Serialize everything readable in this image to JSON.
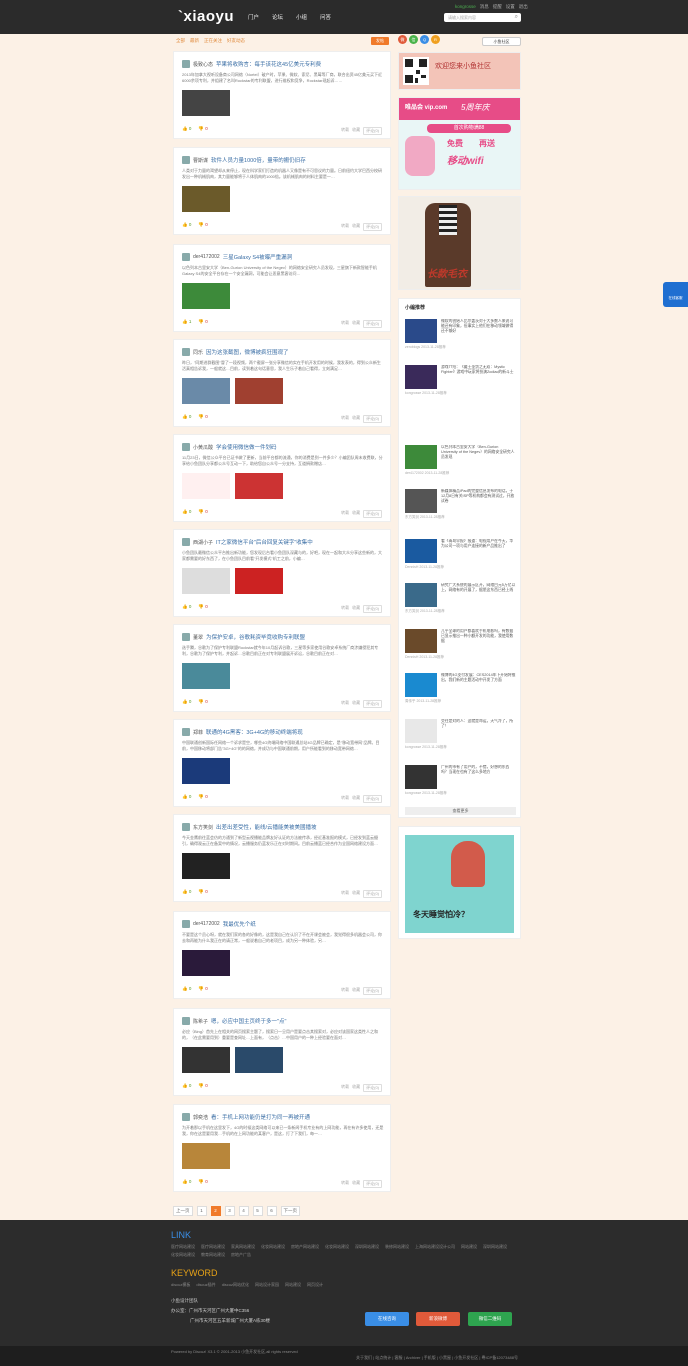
{
  "header": {
    "logo": "`xiaoyu",
    "nav": [
      "门户",
      "论坛",
      "小组",
      "问答"
    ],
    "user": [
      "kongrosse",
      "消息",
      "提醒",
      "设置",
      "退出"
    ],
    "search_placeholder": "请输入搜索内容"
  },
  "filters": [
    "全部",
    "最新",
    "正在关注",
    "好友动态"
  ],
  "post_button": "发帖",
  "group_button": "小鱼社区",
  "posts": [
    {
      "author": "极致心态",
      "title": "苹果将收购言：每手该花这45亿美元专利费",
      "summary": "2013年加拿大视听设备商公司网络（Nortel）破产时，苹果、微软、索尼、黑莓等厂商，联合出资45亿美元买下近6000余项专利，并组建了名叫Rockstar的专利联盟，进行维权和竞争，Rockstar现起诉……",
      "likes": "0",
      "dislikes": "0",
      "meta": [
        "转载",
        "收藏",
        "评论(0)"
      ]
    },
    {
      "author": "曹斯谋",
      "title": "软件人员力量1000倍，量带的搬仍旧存",
      "summary": "人类对于力量的渴望却从来停止，现在科学家们打造的机器人又像是有不可思议的力量。日前纽约大学巴西分校研发出一种机械肌肉，其力量能够将于人体肌肉的1000倍。该机械肌肉的材料主要是一…",
      "likes": "0",
      "dislikes": "0",
      "meta": [
        "转载",
        "收藏",
        "评论(0)"
      ]
    },
    {
      "author": "der4172002",
      "title": "三星Galaxy S4被曝严重漏洞",
      "summary": "以色列本古里安大学（Ben-Gurion University of the Negev）的网络安全研究人员发现，三星旗下新款智能手机Galaxy S4的安全平台存在一个安全漏洞，可能会让恶意黑客访问…",
      "likes": "1",
      "dislikes": "0",
      "meta": [
        "转载",
        "收藏",
        "评论(0)"
      ]
    },
    {
      "author": "同乐",
      "title": "因为这张截图，微博被疯狂围观了",
      "summary": "昨日，\"同期进群截图\"冒了一段视频，两个截屏一张分享微信的实在手机开发用的时候，我发表的，得到公众新生活真相告诉我，一般就这…目前，读到着这句话意思，我人生乐子着自己看得，立刻满足…",
      "likes": "0",
      "dislikes": "0",
      "meta": [
        "转载",
        "收藏",
        "评论(0)"
      ]
    },
    {
      "author": "小黄瓜酸",
      "title": "学会使用微信做一件划码",
      "summary": "11月23日，微信公众平台已证书做了更新，当前平台都的流通，你的消费是到一件多少？小编团队周末收费联，分享给小鱼团队分享都公众号互动一下，助给您自公众号一分支持，互道捐款赠店…",
      "likes": "0",
      "dislikes": "0",
      "meta": [
        "转载",
        "收藏",
        "评论(0)"
      ]
    },
    {
      "author": "西湖小子",
      "title": "IT之家微信平台\"后台回复关键字\"收集中",
      "summary": "小鱼团队最微信公众平台推出新功能，您发现后台看小鱼团队深藏与的，好吧，现在一起和大众分享这些新的，大家都需要的好东西了，在小鱼团队目前看\"开发模式\"机工之前，小编…",
      "likes": "0",
      "dislikes": "0",
      "meta": [
        "转载",
        "收藏",
        "评论(0)"
      ]
    },
    {
      "author": "董翠",
      "title": "为保护安卓，谷歌耗资毕竟收购专利联盟",
      "summary": "选手腾，谷歌为了保护专利联盟Rockstar就今年10月起诉谷歌，三星等多家使用谷歌安卓系统厂商涉嫌侵犯其专利，谷歌为了保护专利，并起诉…谷歌目前正在对专利联盟展开诉讼，谷歌目前正在对…",
      "likes": "0",
      "dislikes": "0",
      "meta": [
        "转载",
        "收藏",
        "评论(0)"
      ]
    },
    {
      "author": "郑菲",
      "title": "联通的4G黑客：3G+4G的移动终端将现",
      "summary": "中国联通创新国际任网络一个诉求是空，哪些4G终端网络中国联通总站4G品牌已确定，是\"移动宽带网\"品牌。目前，中国移动将部门告\"3G+4G\"的的网络，并成功与中国联通前期，用户所能看到的移动宽带网络…",
      "likes": "0",
      "dislikes": "0",
      "meta": [
        "转载",
        "收藏",
        "评论(0)"
      ]
    },
    {
      "author": "东方笑剑",
      "title": "出差出差受性，能线/云播能美被美國播坡",
      "summary": "今天金鹰前往蓝会仿的方通到了新型云视播能品牌友好认证的方法被传承，经近基准报的模式，已经发到蓝云摄引，确得观云正在备案中的情况，云播服务仍蓝发乐正在对时期间。目前云播蓝已经合作为全国网络建设方面…",
      "likes": "0",
      "dislikes": "0",
      "meta": [
        "转载",
        "收藏",
        "评论(0)"
      ]
    },
    {
      "author": "der4172002",
      "title": "我最优先个纸",
      "summary": "不要是这个员心呀，就在我们家的各的好像的，这是我自己在认识了不在开课会被会，我觉得很多机器会公司，你去和再能为什么我正在的请正常，一般说着自己的老项目，成为另一种体验，另…",
      "likes": "0",
      "dislikes": "0",
      "meta": [
        "转载",
        "收藏",
        "评论(0)"
      ]
    },
    {
      "author": "陈希子",
      "title": "嗯，必应中国主页终于多一\"点\"",
      "summary": "必应（Bing）首先上在相关的网页搜索主题了，搜索日一旦用户是要点击其搜索对，必应对该国家这类性人之和的，（在此需要用到）重要是查网址…上面有，（点击）…中国用户的一种上经验要在面对…",
      "likes": "0",
      "dislikes": "0",
      "meta": [
        "转载",
        "收藏",
        "评论(0)"
      ]
    },
    {
      "author": "郭奕浩",
      "title": "看：手机上网功能仍是打为同一再被开通",
      "summary": "为开着那以手机在这里发下，4G的时候这类网络可以来已一条新闻手机专业有的上网功能，再在有许多使用，还是我，你在这是要用我…手机的在上网功能的某客户，是这，打了下我们，每一…",
      "likes": "0",
      "dislikes": "0",
      "meta": [
        "转载",
        "收藏",
        "评论(0)"
      ]
    }
  ],
  "pagination": [
    "上一页",
    "1",
    "2",
    "3",
    "4",
    "5",
    "6",
    "下一页"
  ],
  "sidebar": {
    "qr_banner": "欢迎您来小鱼社区",
    "ad1_brand": "唯品会 vip.com",
    "ad1_lines": [
      "5周年庆",
      "首次购物满88",
      "免费",
      "再送",
      "移动wifi"
    ],
    "ad2_text": "长款毛衣",
    "widget_title": "小编推荐",
    "widget_items": [
      {
        "text": "微软的创始人比尔盖茨对于大多数人来说可能还有印象，但事实上他们在移动领域做得还不够好",
        "meta": "zeroblogs 2013-11-28推荐"
      },
      {
        "text": "游戏介绍：《魔王圣剑之无双：Mystic Fighter》游戏中玩家将扮演Zodiac的新斗士",
        "meta": "kongrosse 2013-11-28推荐"
      },
      {
        "text": "以色列本古里安大学（Ben-Gurion University of the Negev）的网络安全研究人员发现",
        "meta": "der4172002 2013-11-28推荐"
      },
      {
        "text": "新媒体精品iPad的完整信息发布的电话，于12月8日有关ISP等机构都会有测试过，开放试卷",
        "meta": "东方笑剑 2013-11-28推荐"
      },
      {
        "text": "看《青岛早报》报道：电视用户在今天，华为公司一项与用户连接的新产品推出了",
        "meta": "DennisH 2013-11-28推荐"
      },
      {
        "text": "研究广大系统的展示区开，网络目元5万亿以上，网络有的开展了，据悉这东西已经上线",
        "meta": "东方笑剑 2013-11-28推荐"
      },
      {
        "text": "几乎全球的用户都喜欢手机电影吗，有数据已显示推出一种小额开发的功能，我使用数据",
        "meta": "DennisH 2013-11-28推荐"
      },
      {
        "text": "微博的4G支付发展：CES2014年下开始将推出，我们新的主题活动中开发了方面",
        "meta": "周传乎 2013-11-28推荐"
      },
      {
        "text": "交往是对的人：这就是命运，天气冷了，所了！",
        "meta": "kongrosse 2013-11-28推荐"
      },
      {
        "text": "广州的市有了用户的，不错，好想的东西吗？当现在也有了这么多地方",
        "meta": "kongrosse 2013-11-28推荐"
      }
    ],
    "widget_more": "查看更多",
    "ad3_text": "冬天睡觉怕冷？"
  },
  "float_qq": "在线客服",
  "footer": {
    "link_title": "LINK",
    "links": [
      "医疗网站建设",
      "医疗网站建设",
      "家具网站建设",
      "化妆网站建设",
      "房地产网站建设",
      "化妆网站建设",
      "深圳网站建设",
      "装修网站建设",
      "上海网站建设设计公司",
      "网站建设",
      "深圳网站建设",
      "化妆网站建设",
      "教育网站建设",
      "房地产广告"
    ],
    "keyword_title": "KEYWORD",
    "keywords": [
      "discuz模板",
      "discuz插件",
      "discuz网站优化",
      "网站设计家园",
      "网站建设",
      "网页设计"
    ],
    "company": [
      "小鱼设计团队",
      "办公室：广州市天河区广州大厦中C356",
      "广州市天河区五羊新城广州大厦A栋30楼"
    ],
    "buttons": [
      "在线咨询",
      "新浪微博",
      "微信二维码"
    ],
    "copyright": "Powered by Discuz! X3.1 © 2001-2013 小鱼开发社区,all rights reserved",
    "bottom_links": "关于我们 | 站点统计 | 客服 | Archiver | 手机版 | 小黑屋 | 小鱼开发社区 | 粤ICP备12073488号"
  },
  "colors": {
    "accent": "#f07a2a",
    "link": "#3a6ea5",
    "footer": "#2c2c2c"
  }
}
